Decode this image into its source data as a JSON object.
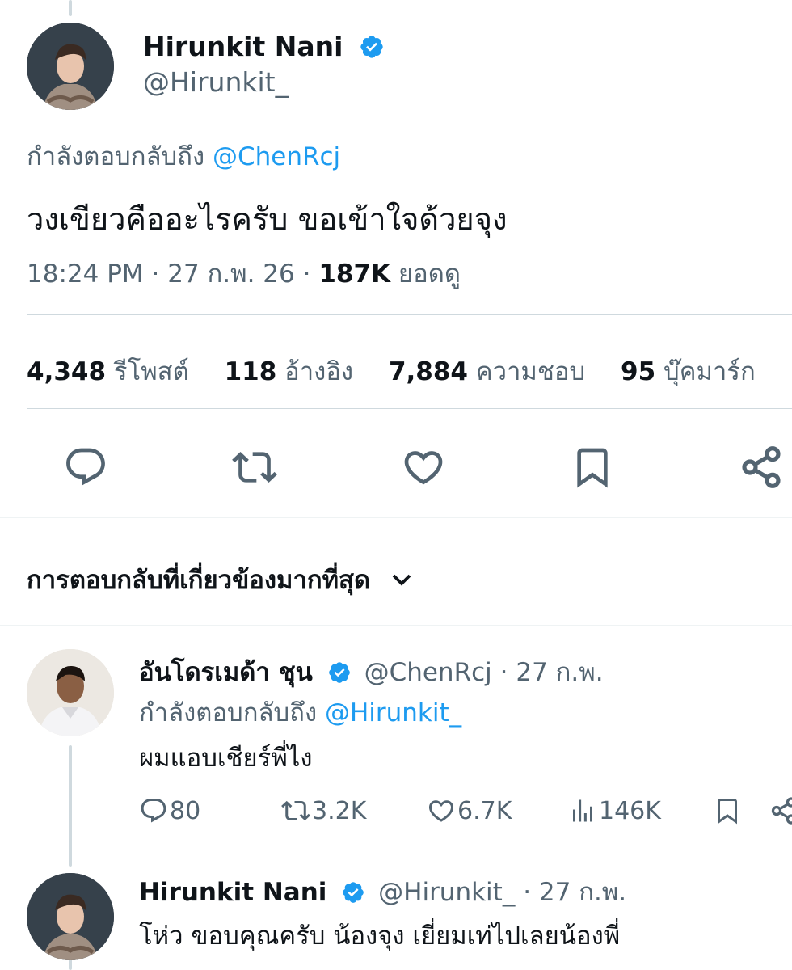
{
  "main_tweet": {
    "author_name": "Hirunkit Nani",
    "author_handle": "@Hirunkit_",
    "reply_prefix": "กำลังตอบกลับถึง",
    "reply_to": "@ChenRcj",
    "text": "วงเขียวคืออะไรครับ ขอเข้าใจด้วยจุง",
    "time": "18:24 PM",
    "date": "27 ก.พ. 26",
    "views_count": "187K",
    "views_label": "ยอดดู"
  },
  "stats": {
    "reposts_count": "4,348",
    "reposts_label": "รีโพสต์",
    "quotes_count": "118",
    "quotes_label": "อ้างอิง",
    "likes_count": "7,884",
    "likes_label": "ความชอบ",
    "bookmarks_count": "95",
    "bookmarks_label": "บุ๊คมาร์ก"
  },
  "actions": [
    "reply-icon",
    "retweet-icon",
    "heart-icon",
    "bookmark-icon",
    "share-icon"
  ],
  "replies_sort": {
    "label": "การตอบกลับที่เกี่ยวข้องมากที่สุด"
  },
  "reply1": {
    "author_name": "อันโดรเมด้า ชุน",
    "author_handle": "@ChenRcj",
    "date": "· 27 ก.พ.",
    "reply_prefix": "กำลังตอบกลับถึง",
    "reply_to": "@Hirunkit_",
    "text": "ผมแอบเชียร์พี่ไง",
    "replies": "80",
    "reposts": "3.2K",
    "likes": "6.7K",
    "views": "146K"
  },
  "reply2": {
    "author_name": "Hirunkit Nani",
    "author_handle": "@Hirunkit_",
    "date": "· 27 ก.พ.",
    "text": "โห่ว ขอบคุณครับ น้องจุง เยี่ยมเท่ไปเลยน้องพี่"
  },
  "colors": {
    "accent": "#1d9bf0",
    "secondary_text": "#536471",
    "divider": "#cfd9de"
  }
}
